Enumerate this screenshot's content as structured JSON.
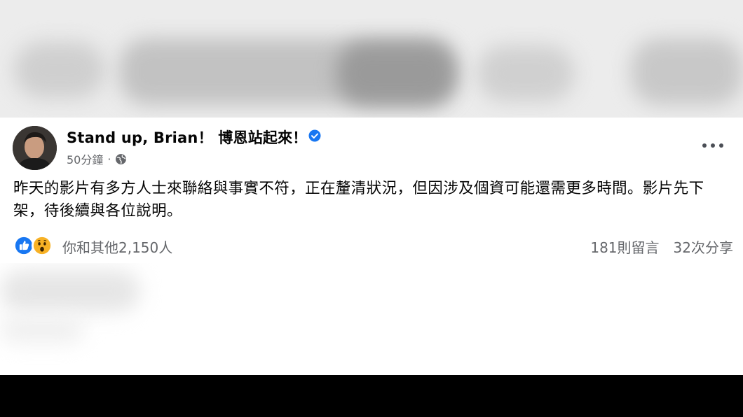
{
  "post": {
    "author": "Stand up, Brian！ 博恩站起來！",
    "time": "50分鐘",
    "separator": "·",
    "text": "昨天的影片有多方人士來聯絡與事實不符，正在釐清狀況，但因涉及個資可能還需更多時間。影片先下架，待後續與各位說明。",
    "reactions": {
      "icons": [
        "like-icon",
        "wow-icon"
      ],
      "summary": "你和其他2,150人"
    },
    "comments": "181則留言",
    "shares": "32次分享"
  },
  "colors": {
    "like_blue": "#1877f2",
    "verified_blue": "#1877f2",
    "wow_yellow": "#f7b125",
    "secondary_text": "#65676b"
  }
}
